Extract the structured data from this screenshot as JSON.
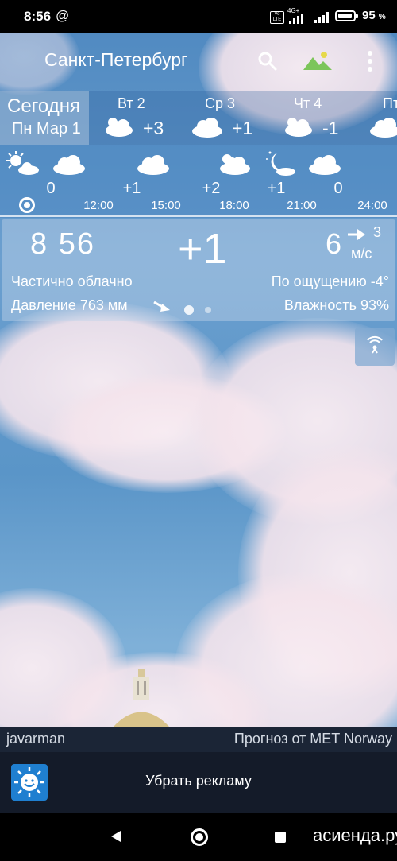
{
  "status_bar": {
    "time": "8:56",
    "at_symbol": "@",
    "volte": "Vo LTE",
    "network": "4G+",
    "battery_percent": "95",
    "battery_unit": "%",
    "battery_level": 0.95
  },
  "app_bar": {
    "city": "Санкт-Петербург",
    "search_icon": "search-icon",
    "background_icon": "landscape-image-icon",
    "menu_icon": "more-vert-icon"
  },
  "days": {
    "today": {
      "name": "Сегодня",
      "date": "Пн Мар 1"
    },
    "items": [
      {
        "name": "Вт 2",
        "temp": "+3",
        "icon": "cloud-sun-icon"
      },
      {
        "name": "Ср 3",
        "temp": "+1",
        "icon": "cloud-icon"
      },
      {
        "name": "Чт 4",
        "temp": "-1",
        "icon": "cloud-sun-icon"
      },
      {
        "name": "Пт",
        "temp": "",
        "icon": "cloud-icon"
      }
    ]
  },
  "hourly": {
    "icons": [
      "sun-cloud-icon",
      "cloud-icon",
      "cloud-icon",
      "sun-cloud-icon",
      "moon-cloud-icon",
      "cloud-icon"
    ],
    "temps": [
      "0",
      "+1",
      "+2",
      "+1",
      "0"
    ],
    "times": [
      "12:00",
      "15:00",
      "18:00",
      "21:00",
      "24:00"
    ]
  },
  "current": {
    "time": "8  56",
    "temp": "+1",
    "wind_value": "6",
    "wind_speed": "3",
    "wind_unit": "м/с",
    "condition": "Частично облачно",
    "feels_like": "По ощущению -4°",
    "pressure": "Давление 763 мм",
    "humidity": "Влажность 93%"
  },
  "radar_icon": "radar-icon",
  "credits": {
    "user": "javarman",
    "source": "Прогноз от MET Norway"
  },
  "ad": {
    "label": "Убрать рекламу",
    "icon": "sun-smile-icon"
  },
  "nav": {
    "watermark": "асиенда.ру"
  },
  "colors": {
    "panel_dark": "#141b29",
    "credit_bar": "#1b2536",
    "ad_icon_blue": "#1f7fd0"
  }
}
